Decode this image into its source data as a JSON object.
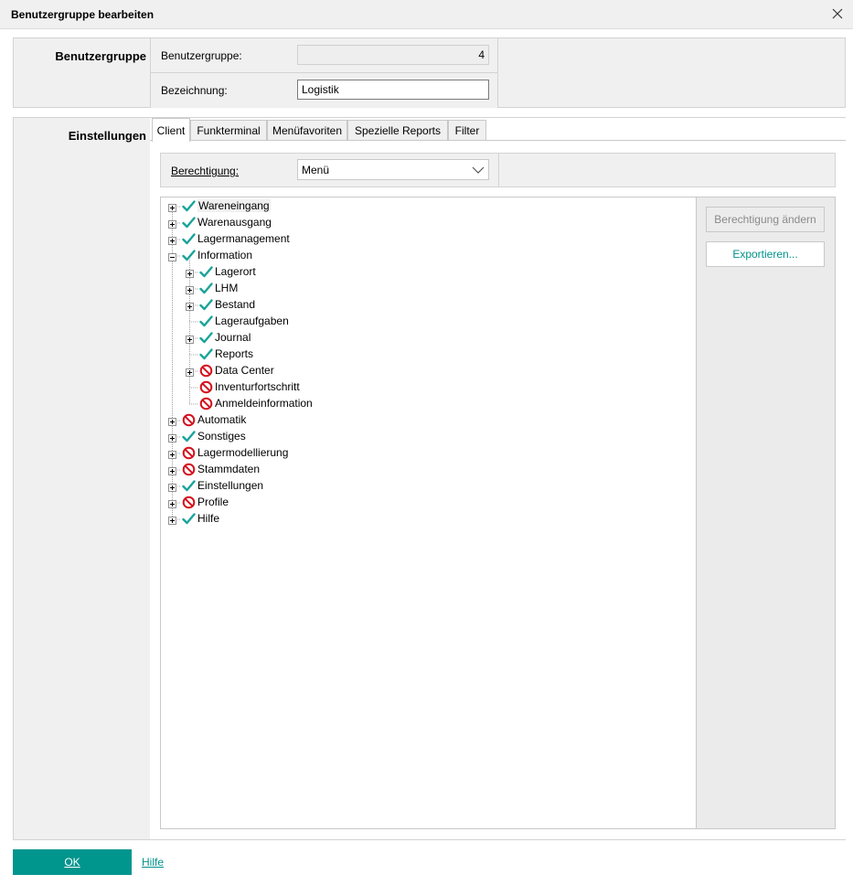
{
  "window": {
    "title": "Benutzergruppe bearbeiten"
  },
  "group": {
    "section_label": "Benutzergruppe",
    "id_label": "Benutzergruppe:",
    "id_value": "4",
    "name_label": "Bezeichnung:",
    "name_value": "Logistik"
  },
  "settings": {
    "section_label": "Einstellungen",
    "tabs": [
      {
        "label": "Client",
        "active": true
      },
      {
        "label": "Funkterminal",
        "active": false
      },
      {
        "label": "Menüfavoriten",
        "active": false
      },
      {
        "label": "Spezielle Reports",
        "active": false
      },
      {
        "label": "Filter",
        "active": false
      }
    ],
    "permission_label": "Berechtigung:",
    "permission_value": "Menü",
    "buttons": {
      "change_permission": "Berechtigung ändern",
      "export": "Exportieren..."
    },
    "tree": [
      {
        "label": "Wareneingang",
        "status": "allowed",
        "level": 0,
        "expander": "plus"
      },
      {
        "label": "Warenausgang",
        "status": "allowed",
        "level": 0,
        "expander": "plus"
      },
      {
        "label": "Lagermanagement",
        "status": "allowed",
        "level": 0,
        "expander": "plus"
      },
      {
        "label": "Information",
        "status": "allowed",
        "level": 0,
        "expander": "minus"
      },
      {
        "label": "Lagerort",
        "status": "allowed",
        "level": 1,
        "expander": "plus"
      },
      {
        "label": "LHM",
        "status": "allowed",
        "level": 1,
        "expander": "plus"
      },
      {
        "label": "Bestand",
        "status": "allowed",
        "level": 1,
        "expander": "plus"
      },
      {
        "label": "Lageraufgaben",
        "status": "allowed",
        "level": 1,
        "expander": "none"
      },
      {
        "label": "Journal",
        "status": "allowed",
        "level": 1,
        "expander": "plus"
      },
      {
        "label": "Reports",
        "status": "allowed",
        "level": 1,
        "expander": "none"
      },
      {
        "label": "Data Center",
        "status": "denied",
        "level": 1,
        "expander": "plus"
      },
      {
        "label": "Inventurfortschritt",
        "status": "denied",
        "level": 1,
        "expander": "none"
      },
      {
        "label": "Anmeldeinformation",
        "status": "denied",
        "level": 1,
        "expander": "none"
      },
      {
        "label": "Automatik",
        "status": "denied",
        "level": 0,
        "expander": "plus"
      },
      {
        "label": "Sonstiges",
        "status": "allowed",
        "level": 0,
        "expander": "plus"
      },
      {
        "label": "Lagermodellierung",
        "status": "denied",
        "level": 0,
        "expander": "plus"
      },
      {
        "label": "Stammdaten",
        "status": "denied",
        "level": 0,
        "expander": "plus"
      },
      {
        "label": "Einstellungen",
        "status": "allowed",
        "level": 0,
        "expander": "plus"
      },
      {
        "label": "Profile",
        "status": "denied",
        "level": 0,
        "expander": "plus"
      },
      {
        "label": "Hilfe",
        "status": "allowed",
        "level": 0,
        "expander": "plus"
      }
    ]
  },
  "footer": {
    "ok_label": "OK",
    "help_label": "Hilfe"
  },
  "colors": {
    "accent": "#00958d",
    "allowed": "#1aa39a",
    "denied": "#d4121e"
  }
}
